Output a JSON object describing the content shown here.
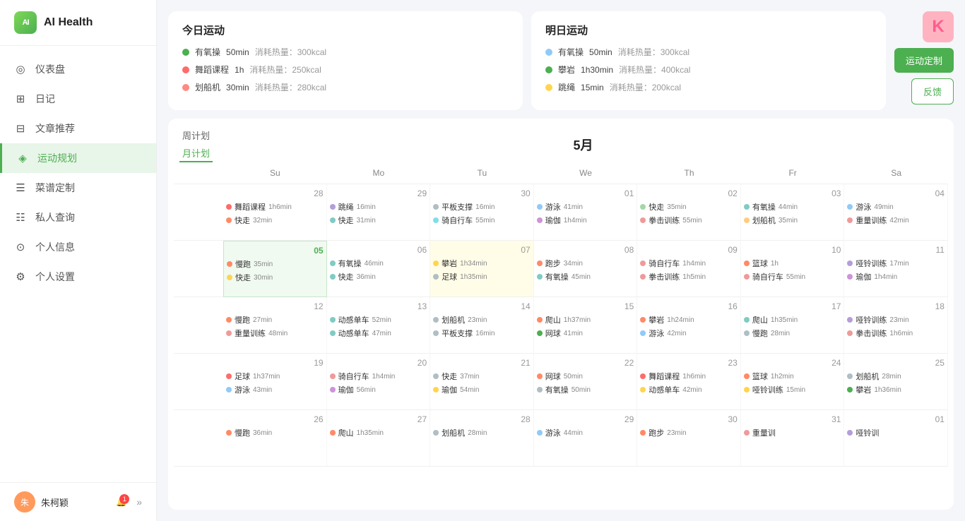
{
  "app": {
    "name": "AI Health",
    "logo_letter": "AI"
  },
  "sidebar": {
    "nav_items": [
      {
        "id": "dashboard",
        "label": "仪表盘",
        "icon": "◎",
        "active": false
      },
      {
        "id": "diary",
        "label": "日记",
        "icon": "⊞",
        "active": false
      },
      {
        "id": "articles",
        "label": "文章推荐",
        "icon": "⊟",
        "active": false
      },
      {
        "id": "exercise",
        "label": "运动规划",
        "icon": "◈",
        "active": true
      },
      {
        "id": "menu",
        "label": "菜谱定制",
        "icon": "☰",
        "active": false
      },
      {
        "id": "query",
        "label": "私人查询",
        "icon": "☷",
        "active": false
      },
      {
        "id": "profile",
        "label": "个人信息",
        "icon": "⊙",
        "active": false
      },
      {
        "id": "settings",
        "label": "个人设置",
        "icon": "⚙",
        "active": false
      }
    ],
    "user": {
      "name": "朱柯颖",
      "avatar_text": "朱",
      "notification_count": "1"
    }
  },
  "today_exercise": {
    "title": "今日运动",
    "items": [
      {
        "name": "有氧操",
        "duration": "50min",
        "calories": "消耗热量：300kcal",
        "color": "#4caf50"
      },
      {
        "name": "舞蹈课程",
        "duration": "1h",
        "calories": "消耗热量：250kcal",
        "color": "#ff6b6b"
      },
      {
        "name": "划船机",
        "duration": "30min",
        "calories": "消耗热量：280kcal",
        "color": "#ff8a80"
      }
    ]
  },
  "tomorrow_exercise": {
    "title": "明日运动",
    "items": [
      {
        "name": "有氧操",
        "duration": "50min",
        "calories": "消耗热量：300kcal",
        "color": "#90caf9"
      },
      {
        "name": "攀岩",
        "duration": "1h30min",
        "calories": "消耗热量：400kcal",
        "color": "#4caf50"
      },
      {
        "name": "跳绳",
        "duration": "15min",
        "calories": "消耗热量：200kcal",
        "color": "#ffd54f"
      }
    ]
  },
  "buttons": {
    "customize": "运动定制",
    "feedback": "反馈"
  },
  "calendar": {
    "month_title": "5月",
    "week_days": [
      "Su",
      "Mo",
      "Tu",
      "We",
      "Th",
      "Fr",
      "Sa"
    ],
    "tabs": [
      "周计划",
      "月计划"
    ],
    "active_tab": "月计划",
    "weeks": [
      {
        "label": "",
        "days": [
          {
            "date": "28",
            "workouts": [
              {
                "name": "舞蹈课程",
                "time": "1h6min",
                "color": "#ff6b6b"
              },
              {
                "name": "快走",
                "time": "32min",
                "color": "#ff8a65"
              }
            ]
          },
          {
            "date": "29",
            "workouts": [
              {
                "name": "跳绳",
                "time": "16min",
                "color": "#b39ddb"
              },
              {
                "name": "快走",
                "time": "31min",
                "color": "#80cbc4"
              }
            ]
          },
          {
            "date": "30",
            "workouts": [
              {
                "name": "平板支撑",
                "time": "16min",
                "color": "#b0bec5"
              },
              {
                "name": "骑自行车",
                "time": "55min",
                "color": "#80deea"
              }
            ]
          },
          {
            "date": "01",
            "workouts": [
              {
                "name": "游泳",
                "time": "41min",
                "color": "#90caf9"
              },
              {
                "name": "瑜伽",
                "time": "1h4min",
                "color": "#ce93d8"
              }
            ]
          },
          {
            "date": "02",
            "workouts": [
              {
                "name": "快走",
                "time": "35min",
                "color": "#a5d6a7"
              },
              {
                "name": "拳击训练",
                "time": "55min",
                "color": "#ef9a9a"
              }
            ]
          },
          {
            "date": "03",
            "workouts": [
              {
                "name": "有氧操",
                "time": "44min",
                "color": "#80cbc4"
              },
              {
                "name": "划船机",
                "time": "35min",
                "color": "#ffcc80"
              }
            ]
          },
          {
            "date": "04",
            "workouts": [
              {
                "name": "游泳",
                "time": "49min",
                "color": "#90caf9"
              },
              {
                "name": "重量训练",
                "time": "42min",
                "color": "#ef9a9a"
              }
            ]
          }
        ]
      },
      {
        "label": "",
        "days": [
          {
            "date": "05",
            "today": true,
            "workouts": [
              {
                "name": "慢跑",
                "time": "35min",
                "color": "#ff8a65"
              },
              {
                "name": "快走",
                "time": "30min",
                "color": "#ffd54f"
              }
            ]
          },
          {
            "date": "06",
            "workouts": [
              {
                "name": "有氧操",
                "time": "46min",
                "color": "#80cbc4"
              },
              {
                "name": "快走",
                "time": "36min",
                "color": "#80cbc4"
              }
            ]
          },
          {
            "date": "07",
            "highlight": true,
            "workouts": [
              {
                "name": "攀岩",
                "time": "1h34min",
                "color": "#ffd54f"
              },
              {
                "name": "足球",
                "time": "1h35min",
                "color": "#b0bec5"
              }
            ]
          },
          {
            "date": "08",
            "workouts": [
              {
                "name": "跑步",
                "time": "34min",
                "color": "#ff8a65"
              },
              {
                "name": "有氧操",
                "time": "45min",
                "color": "#80cbc4"
              }
            ]
          },
          {
            "date": "09",
            "workouts": [
              {
                "name": "骑自行车",
                "time": "1h4min",
                "color": "#ef9a9a"
              },
              {
                "name": "拳击训练",
                "time": "1h5min",
                "color": "#ef9a9a"
              }
            ]
          },
          {
            "date": "10",
            "workouts": [
              {
                "name": "篮球",
                "time": "1h",
                "color": "#ff8a65"
              },
              {
                "name": "骑自行车",
                "time": "55min",
                "color": "#ef9a9a"
              }
            ]
          },
          {
            "date": "11",
            "workouts": [
              {
                "name": "哑铃训练",
                "time": "17min",
                "color": "#b39ddb"
              },
              {
                "name": "瑜伽",
                "time": "1h4min",
                "color": "#ce93d8"
              }
            ]
          }
        ]
      },
      {
        "label": "",
        "days": [
          {
            "date": "12",
            "workouts": [
              {
                "name": "慢跑",
                "time": "27min",
                "color": "#ff8a65"
              },
              {
                "name": "重量训练",
                "time": "48min",
                "color": "#ef9a9a"
              }
            ]
          },
          {
            "date": "13",
            "workouts": [
              {
                "name": "动感单车",
                "time": "52min",
                "color": "#80cbc4"
              },
              {
                "name": "动感单车",
                "time": "47min",
                "color": "#80cbc4"
              }
            ]
          },
          {
            "date": "14",
            "workouts": [
              {
                "name": "划船机",
                "time": "23min",
                "color": "#b0bec5"
              },
              {
                "name": "平板支撑",
                "time": "16min",
                "color": "#b0bec5"
              }
            ]
          },
          {
            "date": "15",
            "workouts": [
              {
                "name": "爬山",
                "time": "1h37min",
                "color": "#ff8a65"
              },
              {
                "name": "网球",
                "time": "41min",
                "color": "#4caf50"
              }
            ]
          },
          {
            "date": "16",
            "workouts": [
              {
                "name": "攀岩",
                "time": "1h24min",
                "color": "#ff8a65"
              },
              {
                "name": "游泳",
                "time": "42min",
                "color": "#90caf9"
              }
            ]
          },
          {
            "date": "17",
            "workouts": [
              {
                "name": "爬山",
                "time": "1h35min",
                "color": "#80cbc4"
              },
              {
                "name": "慢跑",
                "time": "28min",
                "color": "#b0bec5"
              }
            ]
          },
          {
            "date": "18",
            "workouts": [
              {
                "name": "哑铃训练",
                "time": "23min",
                "color": "#b39ddb"
              },
              {
                "name": "拳击训练",
                "time": "1h6min",
                "color": "#ef9a9a"
              }
            ]
          }
        ]
      },
      {
        "label": "",
        "days": [
          {
            "date": "19",
            "workouts": [
              {
                "name": "足球",
                "time": "1h37min",
                "color": "#ff6b6b"
              },
              {
                "name": "游泳",
                "time": "43min",
                "color": "#90caf9"
              }
            ]
          },
          {
            "date": "20",
            "workouts": [
              {
                "name": "骑自行车",
                "time": "1h4min",
                "color": "#ef9a9a"
              },
              {
                "name": "瑜伽",
                "time": "56min",
                "color": "#ce93d8"
              }
            ]
          },
          {
            "date": "21",
            "workouts": [
              {
                "name": "快走",
                "time": "37min",
                "color": "#b0bec5"
              },
              {
                "name": "瑜伽",
                "time": "54min",
                "color": "#ffd54f"
              }
            ]
          },
          {
            "date": "22",
            "workouts": [
              {
                "name": "网球",
                "time": "50min",
                "color": "#ff8a65"
              },
              {
                "name": "有氧操",
                "time": "50min",
                "color": "#b0bec5"
              }
            ]
          },
          {
            "date": "23",
            "workouts": [
              {
                "name": "舞蹈课程",
                "time": "1h6min",
                "color": "#ff6b6b"
              },
              {
                "name": "动感单车",
                "time": "42min",
                "color": "#ffd54f"
              }
            ]
          },
          {
            "date": "24",
            "workouts": [
              {
                "name": "篮球",
                "time": "1h2min",
                "color": "#ff8a65"
              },
              {
                "name": "哑铃训练",
                "time": "15min",
                "color": "#ffd54f"
              }
            ]
          },
          {
            "date": "25",
            "workouts": [
              {
                "name": "划船机",
                "time": "28min",
                "color": "#b0bec5"
              },
              {
                "name": "攀岩",
                "time": "1h36min",
                "color": "#4caf50"
              }
            ]
          }
        ]
      },
      {
        "label": "",
        "days": [
          {
            "date": "26",
            "workouts": [
              {
                "name": "慢跑",
                "time": "36min",
                "color": "#ff8a65"
              }
            ]
          },
          {
            "date": "27",
            "workouts": [
              {
                "name": "爬山",
                "time": "1h35min",
                "color": "#ff8a65"
              }
            ]
          },
          {
            "date": "28",
            "workouts": [
              {
                "name": "划船机",
                "time": "28min",
                "color": "#b0bec5"
              }
            ]
          },
          {
            "date": "29",
            "workouts": [
              {
                "name": "游泳",
                "time": "44min",
                "color": "#90caf9"
              }
            ]
          },
          {
            "date": "30",
            "workouts": [
              {
                "name": "跑步",
                "time": "23min",
                "color": "#ff8a65"
              }
            ]
          },
          {
            "date": "31",
            "workouts": [
              {
                "name": "重量训",
                "time": "",
                "color": "#ef9a9a"
              }
            ]
          },
          {
            "date": "01",
            "workouts": [
              {
                "name": "哑铃训",
                "time": "",
                "color": "#b39ddb"
              }
            ]
          }
        ]
      }
    ]
  }
}
